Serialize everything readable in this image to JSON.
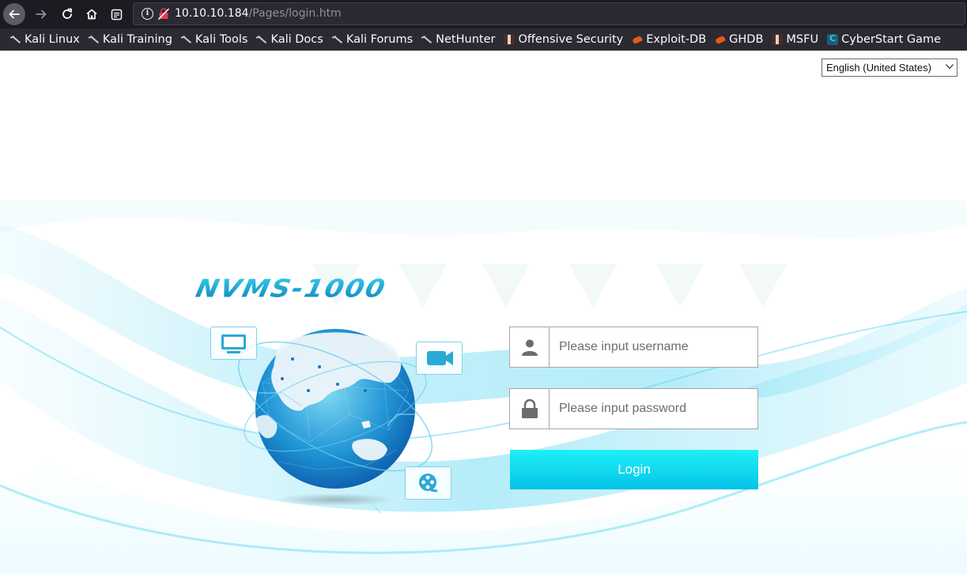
{
  "browser": {
    "url_host": "10.10.10.184",
    "url_path": "/Pages/login.htm",
    "bookmarks": [
      {
        "label": "Kali Linux",
        "icon": "kali-dragon-icon"
      },
      {
        "label": "Kali Training",
        "icon": "kali-dragon-icon"
      },
      {
        "label": "Kali Tools",
        "icon": "kali-dragon-icon"
      },
      {
        "label": "Kali Docs",
        "icon": "kali-dragon-icon"
      },
      {
        "label": "Kali Forums",
        "icon": "kali-dragon-icon"
      },
      {
        "label": "NetHunter",
        "icon": "kali-dragon-icon"
      },
      {
        "label": "Offensive Security",
        "icon": "offsec-icon"
      },
      {
        "label": "Exploit-DB",
        "icon": "exploit-db-icon"
      },
      {
        "label": "GHDB",
        "icon": "exploit-db-icon"
      },
      {
        "label": "MSFU",
        "icon": "offsec-icon"
      },
      {
        "label": "CyberStart Game",
        "icon": "cyberstart-icon"
      }
    ]
  },
  "page": {
    "language": "English (United States)",
    "logo_text": "NVMS-1000",
    "username_placeholder": "Please input username",
    "password_placeholder": "Please input password",
    "login_label": "Login"
  },
  "colors": {
    "accent": "#05c2e8",
    "browser_bg": "#2b2a33",
    "logo": "#1ba4d6"
  }
}
